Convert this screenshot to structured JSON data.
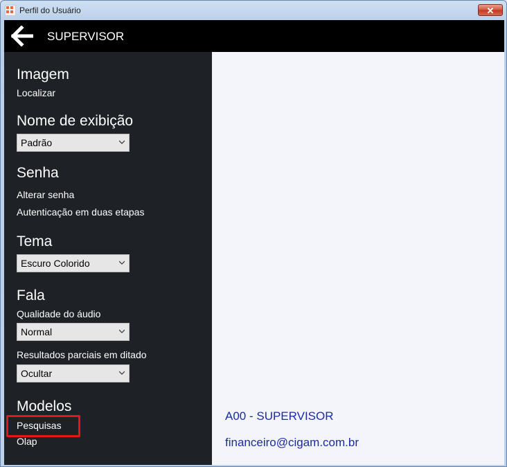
{
  "window": {
    "title": "Perfil do Usuário",
    "close_label": "✕"
  },
  "header": {
    "title": "SUPERVISOR"
  },
  "sidebar": {
    "imagem": {
      "title": "Imagem",
      "link": "Localizar"
    },
    "nome": {
      "title": "Nome de exibição",
      "value": "Padrão"
    },
    "senha": {
      "title": "Senha",
      "links": [
        "Alterar senha",
        "Autenticação em duas etapas"
      ]
    },
    "tema": {
      "title": "Tema",
      "value": "Escuro Colorido"
    },
    "fala": {
      "title": "Fala",
      "quality_label": "Qualidade do áudio",
      "quality_value": "Normal",
      "partial_label": "Resultados parciais em ditado",
      "partial_value": "Ocultar"
    },
    "modelos": {
      "title": "Modelos",
      "links": [
        "Pesquisas",
        "Olap"
      ]
    }
  },
  "content": {
    "user_name": "A00 - SUPERVISOR",
    "user_email": "financeiro@cigam.com.br"
  },
  "colors": {
    "header_bg": "#000000",
    "sidebar_bg": "#1e2126",
    "content_text": "#1b2ba0",
    "highlight": "#e3171b"
  }
}
